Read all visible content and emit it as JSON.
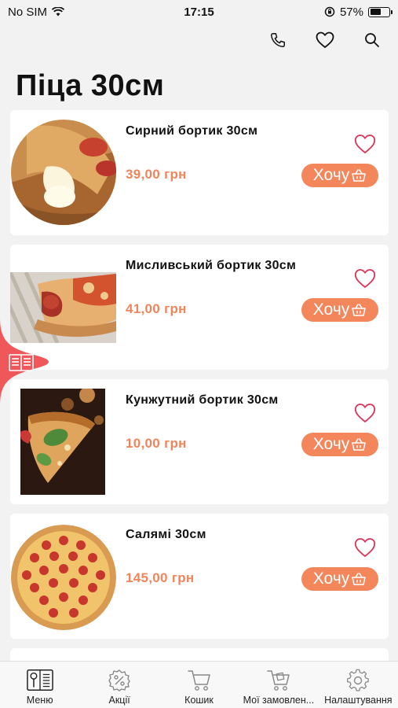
{
  "status_bar": {
    "carrier": "No SIM",
    "time": "17:15",
    "battery_percent": "57%",
    "battery_level": 0.57
  },
  "header": {
    "actions": [
      "phone-icon",
      "heart-icon",
      "search-icon"
    ]
  },
  "page": {
    "title": "Піца 30см"
  },
  "products": [
    {
      "name": "Сирний бортик 30см",
      "price": "39,00 грн",
      "button_label": "Хочу"
    },
    {
      "name": "Мисливський бортик 30см",
      "price": "41,00 грн",
      "button_label": "Хочу"
    },
    {
      "name": "Кунжутний бортик 30см",
      "price": "10,00 грн",
      "button_label": "Хочу"
    },
    {
      "name": "Салямі 30см",
      "price": "145,00 грн",
      "button_label": "Хочу"
    }
  ],
  "bottom_nav": [
    {
      "label": "Меню",
      "icon": "menu-book-icon"
    },
    {
      "label": "Акції",
      "icon": "discount-icon"
    },
    {
      "label": "Кошик",
      "icon": "cart-icon"
    },
    {
      "label": "Мої замовлен...",
      "icon": "orders-icon"
    },
    {
      "label": "Налаштування",
      "icon": "gear-icon"
    }
  ],
  "colors": {
    "accent": "#f4865c",
    "price": "#f0845a",
    "heart": "#d9345a",
    "side_tab": "#f0575a"
  }
}
